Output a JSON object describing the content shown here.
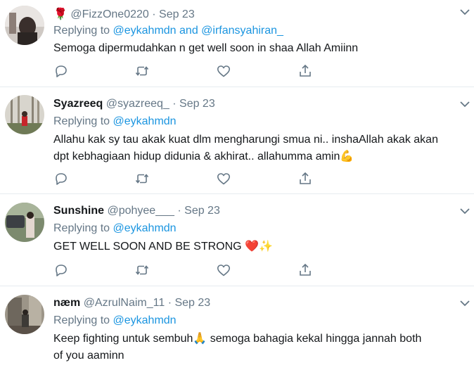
{
  "tweets": [
    {
      "name": "",
      "name_emoji": "🌹",
      "handle": "@FizzOne0220",
      "sep": "·",
      "date": "Sep 23",
      "replying_label": "Replying to",
      "reply_users": [
        "@eykahmdn",
        "@irfansyahiran_"
      ],
      "reply_joiner": "and",
      "text_lines": [
        "Semoga dipermudahkan n get well soon in shaa Allah Amiinn"
      ]
    },
    {
      "name": "Syazreeq",
      "handle": "@syazreeq_",
      "sep": "·",
      "date": "Sep 23",
      "replying_label": "Replying to",
      "reply_users": [
        "@eykahmdn"
      ],
      "text_lines": [
        "Allahu kak sy tau akak kuat dlm mengharungi smua ni.. inshaAllah akak akan",
        "dpt kebhagiaan hidup didunia & akhirat.. allahumma amin💪"
      ]
    },
    {
      "name": "Sunshine",
      "handle": "@pohyee___",
      "sep": "·",
      "date": "Sep 23",
      "replying_label": "Replying to",
      "reply_users": [
        "@eykahmdn"
      ],
      "text_lines": [
        "GET WELL SOON AND BE STRONG ❤️✨"
      ]
    },
    {
      "name": "næm",
      "handle": "@AzrulNaim_11",
      "sep": "·",
      "date": "Sep 23",
      "replying_label": "Replying to",
      "reply_users": [
        "@eykahmdn"
      ],
      "text_lines": [
        "Keep fighting untuk sembuh🙏 semoga bahagia kekal hingga jannah both",
        "of you aaminn"
      ]
    }
  ],
  "icons": [
    "reply-icon",
    "retweet-icon",
    "like-icon",
    "share-icon",
    "chevron-down-icon"
  ],
  "colors": {
    "link": "#1b95e0",
    "muted": "#657786",
    "text": "#14171a",
    "divider": "#e6ecf0"
  }
}
